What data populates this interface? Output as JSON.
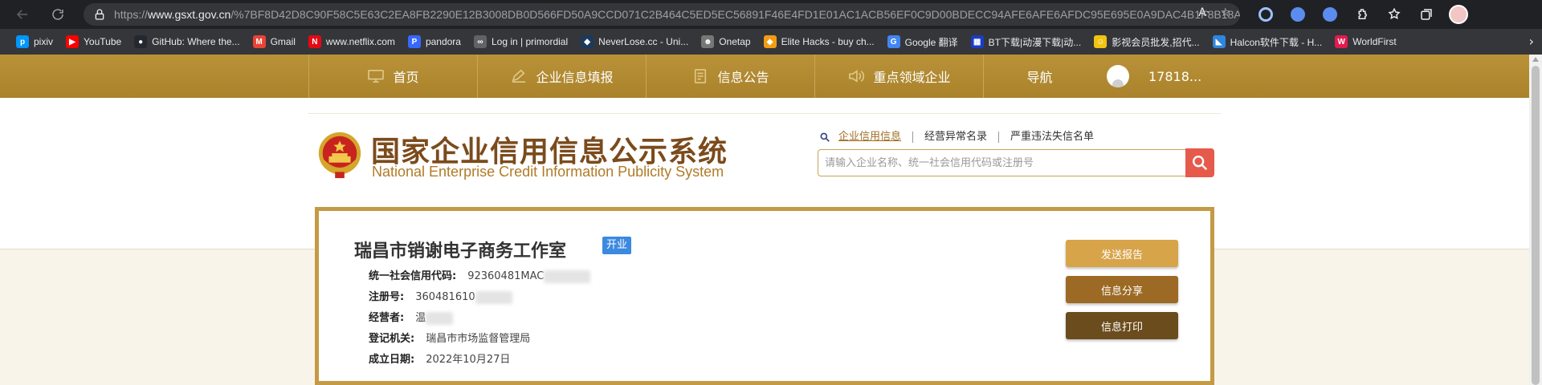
{
  "browser": {
    "url_prefix": "https://",
    "url_host": "www.gsxt.gov.cn",
    "url_path": "/%7BF8D42D8C90F58C5E63C2EA8FB2290E12B3008DB0D566FD50A9CCD071C2B464C5ED5EC56891F46E4FD1E01AC1ACB56EF0C9D00BDECC94AFE6AFE6AFDC95E695E0A9DAC4B1F8B18AD..."
  },
  "bookmarks": [
    {
      "label": "pixiv",
      "icon": "pixiv-icon",
      "color": "#0096fa",
      "glyph": "p"
    },
    {
      "label": "YouTube",
      "icon": "youtube-icon",
      "color": "#ff0000",
      "glyph": "▶"
    },
    {
      "label": "GitHub: Where the...",
      "icon": "github-icon",
      "color": "#24292f",
      "glyph": "●"
    },
    {
      "label": "Gmail",
      "icon": "gmail-icon",
      "color": "#ea4335",
      "glyph": "M"
    },
    {
      "label": "www.netflix.com",
      "icon": "netflix-icon",
      "color": "#e50914",
      "glyph": "N"
    },
    {
      "label": "pandora",
      "icon": "pandora-icon",
      "color": "#3668ff",
      "glyph": "P"
    },
    {
      "label": "Log in | primordial",
      "icon": "primordial-icon",
      "color": "#5f6368",
      "glyph": "∞"
    },
    {
      "label": "NeverLose.cc - Uni...",
      "icon": "neverlose-icon",
      "color": "#1b3a5c",
      "glyph": "◆"
    },
    {
      "label": "Onetap",
      "icon": "onetap-icon",
      "color": "#777777",
      "glyph": "☻"
    },
    {
      "label": "Elite Hacks - buy ch...",
      "icon": "elitehacks-icon",
      "color": "#f39c12",
      "glyph": "◆"
    },
    {
      "label": "Google 翻译",
      "icon": "google-translate-icon",
      "color": "#4285f4",
      "glyph": "G"
    },
    {
      "label": "BT下载|动漫下载|动...",
      "icon": "bt-download-icon",
      "color": "#1a3cc7",
      "glyph": "▦"
    },
    {
      "label": "影视会员批发,招代...",
      "icon": "vip-video-icon",
      "color": "#f1c40f",
      "glyph": "☺"
    },
    {
      "label": "Halcon软件下载 - H...",
      "icon": "halcon-icon",
      "color": "#2e86de",
      "glyph": "◣"
    },
    {
      "label": "WorldFirst",
      "icon": "worldfirst-icon",
      "color": "#e31b4f",
      "glyph": "W"
    }
  ],
  "nav": {
    "items": [
      {
        "label": "首页",
        "icon": "monitor-icon"
      },
      {
        "label": "企业信息填报",
        "icon": "edit-icon"
      },
      {
        "label": "信息公告",
        "icon": "document-icon"
      },
      {
        "label": "重点领域企业",
        "icon": "speaker-icon"
      },
      {
        "label": "导航",
        "icon": ""
      }
    ],
    "user_label": "17818..."
  },
  "header": {
    "title_cn": "国家企业信用信息公示系统",
    "title_en": "National Enterprise Credit Information Publicity System",
    "search_tabs": [
      "企业信用信息",
      "经营异常名录",
      "严重违法失信名单"
    ],
    "search_placeholder": "请输入企业名称、统一社会信用代码或注册号"
  },
  "company": {
    "name": "瑞昌市销谢电子商务工作室",
    "status": "开业",
    "fields": [
      {
        "label": "统一社会信用代码:",
        "value": "92360481MAC"
      },
      {
        "label": "注册号:",
        "value": "360481610"
      },
      {
        "label": "经营者:",
        "value": "温"
      },
      {
        "label": "登记机关:",
        "value": "瑞昌市市场监督管理局"
      },
      {
        "label": "成立日期:",
        "value": "2022年10月27日"
      }
    ],
    "buttons": [
      "发送报告",
      "信息分享",
      "信息打印"
    ]
  },
  "colors": {
    "nav_gold": "#b38a2f",
    "card_border": "#c49a45",
    "badge_blue": "#3c89e0",
    "search_red": "#e65a4c"
  }
}
